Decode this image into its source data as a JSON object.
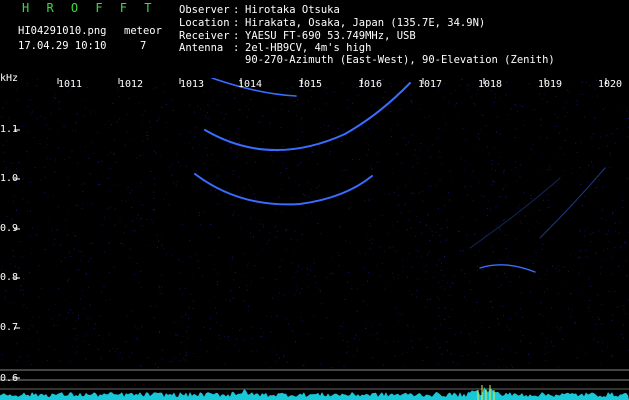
{
  "header": {
    "title": "H R O F F T",
    "filename": "HI04291010.png",
    "datetime": "17.04.29 10:10",
    "meteor_label": "meteor",
    "meteor_count": "7",
    "observer_label": "Observer",
    "observer": "Hirotaka Otsuka",
    "location_label": "Location",
    "location": "Hirakata, Osaka, Japan (135.7E, 34.9N)",
    "receiver_label": "Receiver",
    "receiver": "YAESU FT-690 53.749MHz, USB",
    "antenna_label": "Antenna",
    "antenna": "2el-HB9CV, 4m's high",
    "antenna_line2": "90-270-Azimuth (East-West), 90-Elevation (Zenith)"
  },
  "axes": {
    "y_unit": "kHz",
    "y_ticks": [
      "1.1",
      "1.0",
      "0.9",
      "0.8",
      "0.7",
      "0.6"
    ],
    "x_ticks": [
      "1011",
      "1012",
      "1013",
      "1014",
      "1015",
      "1016",
      "1017",
      "1018",
      "1019",
      "1020"
    ]
  },
  "colors": {
    "background": "#000000",
    "trace": "#3a6cff",
    "noise": "#1a1a80",
    "text": "#ffffff",
    "title": "#3ddc3d",
    "spectrum": "#19c8d8"
  }
}
